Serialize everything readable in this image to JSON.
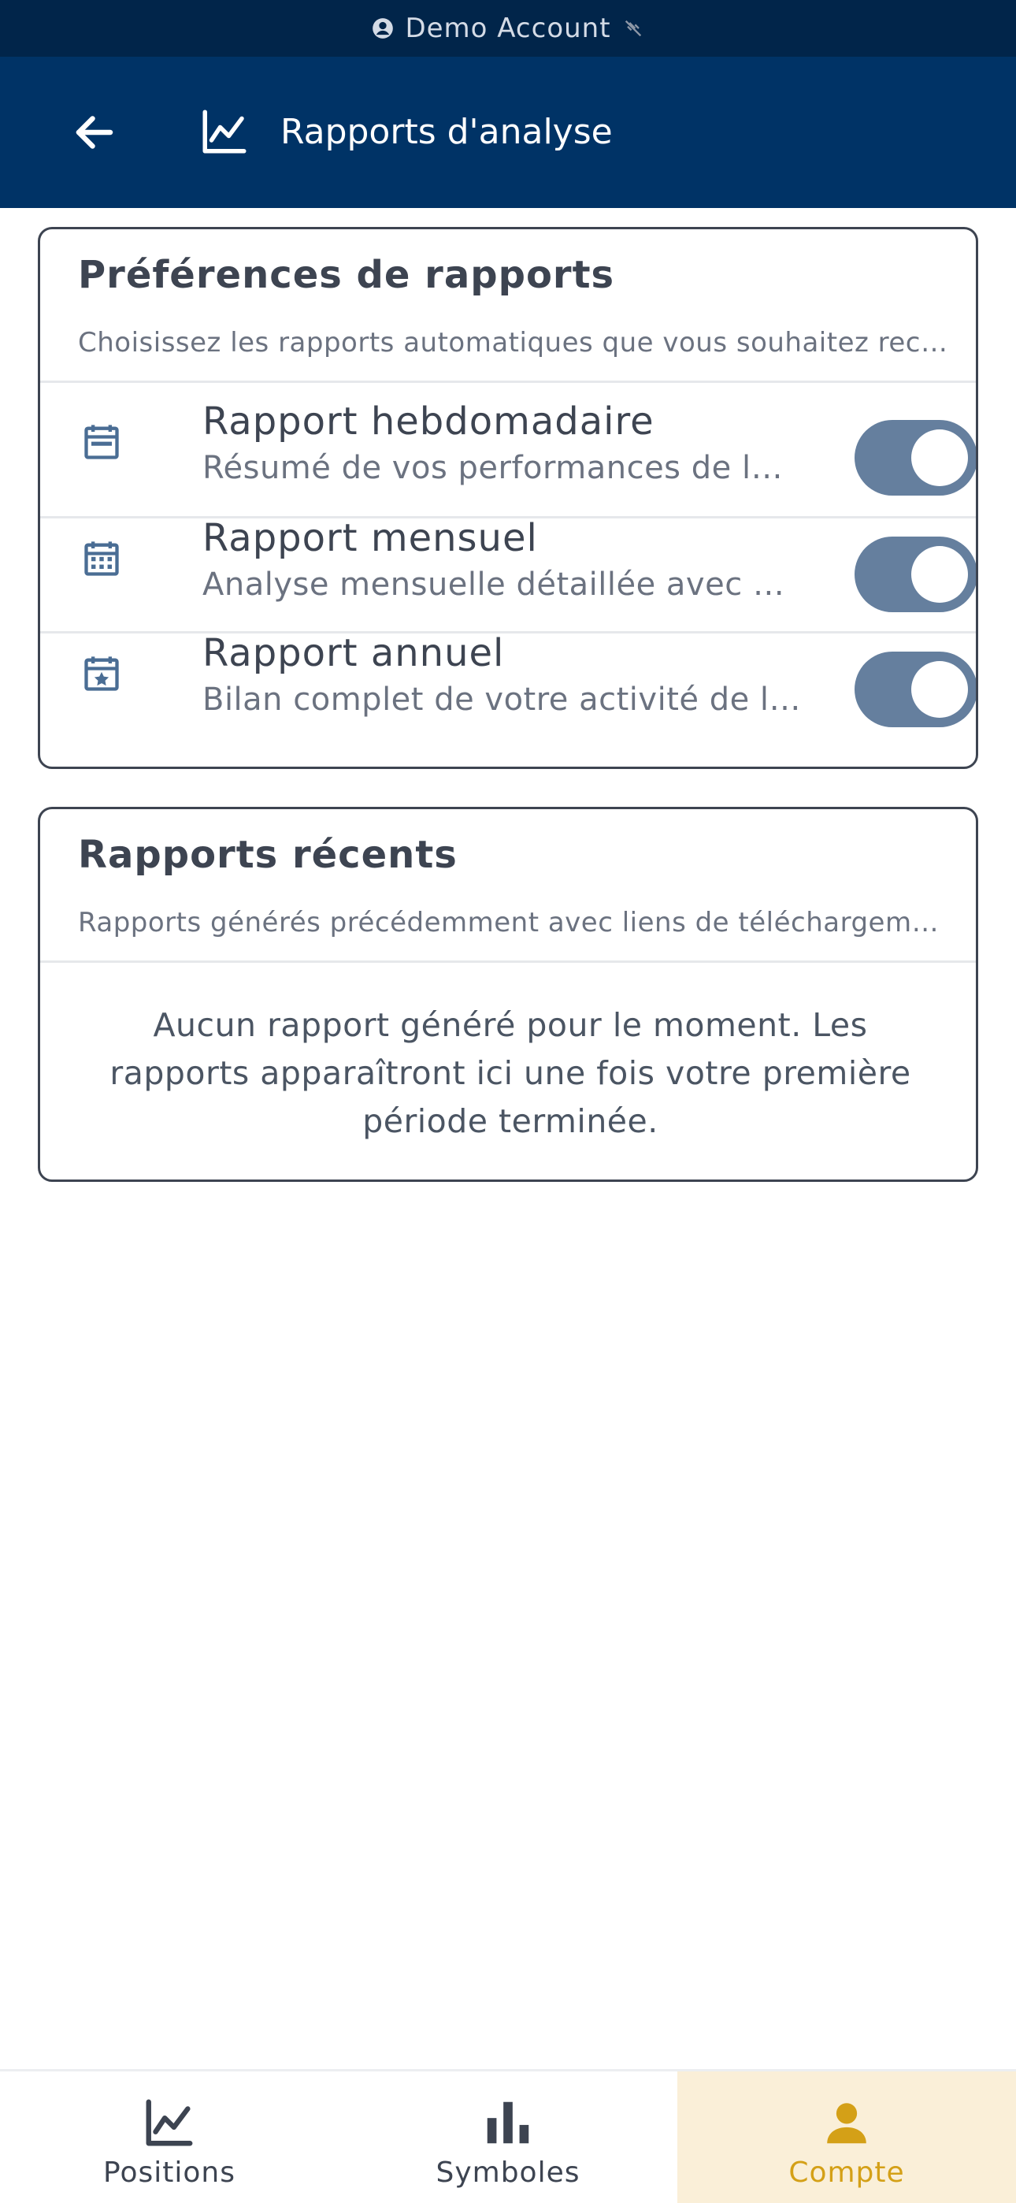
{
  "status_bar": {
    "account_label": "Demo Account"
  },
  "app_bar": {
    "title": "Rapports d'analyse"
  },
  "preferences": {
    "title": "Préférences de rapports",
    "subtitle": "Choisissez les rapports automatiques que vous souhaitez recevoir",
    "items": [
      {
        "title": "Rapport hebdomadaire",
        "description": "Résumé de vos performances de la semaine",
        "enabled": true,
        "icon": "calendar-week-icon"
      },
      {
        "title": "Rapport mensuel",
        "description": "Analyse mensuelle détaillée avec graphiques",
        "enabled": true,
        "icon": "calendar-month-icon"
      },
      {
        "title": "Rapport annuel",
        "description": "Bilan complet de votre activité de l'année",
        "enabled": true,
        "icon": "calendar-star-icon"
      }
    ]
  },
  "recent": {
    "title": "Rapports récents",
    "subtitle": "Rapports générés précédemment avec liens de téléchargement",
    "empty_message": "Aucun rapport généré pour le moment. Les rapports apparaîtront ici une fois votre première période terminée."
  },
  "bottom_nav": {
    "items": [
      {
        "label": "Positions",
        "icon": "chart-line-icon",
        "active": false
      },
      {
        "label": "Symboles",
        "icon": "bar-chart-icon",
        "active": false
      },
      {
        "label": "Compte",
        "icon": "person-icon",
        "active": true
      }
    ]
  },
  "colors": {
    "header_bg": "#003366",
    "status_bg": "#01254a",
    "toggle_on": "#657f9e",
    "accent_active": "#d4a017",
    "active_nav_bg": "#faefd8"
  }
}
